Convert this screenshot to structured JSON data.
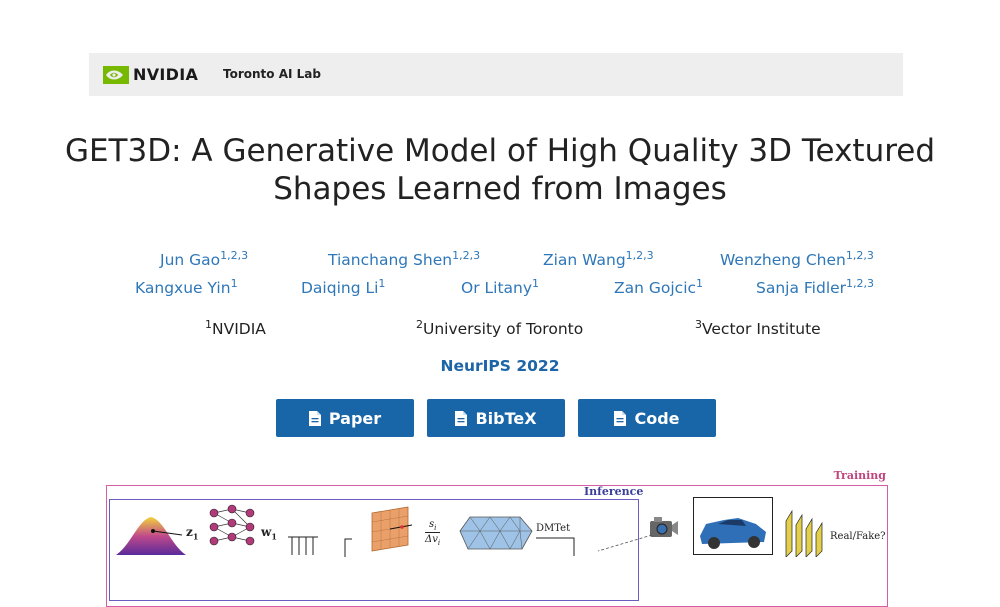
{
  "header": {
    "brand": "NVIDIA",
    "lab": "Toronto AI Lab"
  },
  "title": {
    "line1": "GET3D: A Generative Model of High Quality 3D Textured",
    "line2": "Shapes Learned from Images"
  },
  "authors": [
    {
      "name": "Jun Gao",
      "sup": "1,2,3"
    },
    {
      "name": "Tianchang Shen",
      "sup": "1,2,3"
    },
    {
      "name": "Zian Wang",
      "sup": "1,2,3"
    },
    {
      "name": "Wenzheng Chen",
      "sup": "1,2,3"
    },
    {
      "name": "Kangxue Yin",
      "sup": "1"
    },
    {
      "name": "Daiqing Li",
      "sup": "1"
    },
    {
      "name": "Or Litany",
      "sup": "1"
    },
    {
      "name": "Zan Gojcic",
      "sup": "1"
    },
    {
      "name": "Sanja Fidler",
      "sup": "1,2,3"
    }
  ],
  "affiliations": [
    {
      "sup": "1",
      "name": "NVIDIA"
    },
    {
      "sup": "2",
      "name": "University of Toronto"
    },
    {
      "sup": "3",
      "name": "Vector Institute"
    }
  ],
  "venue": "NeurIPS 2022",
  "buttons": {
    "paper": "Paper",
    "bibtex": "BibTeX",
    "code": "Code"
  },
  "figure": {
    "training_label": "Training",
    "inference_label": "Inference",
    "z1": "z",
    "z1_sub": "1",
    "w1": "w",
    "w1_sub": "1",
    "delta_top": "s",
    "delta_top_sub": "i",
    "delta_bottom": "Δv",
    "delta_bottom_sub": "i",
    "dmtet": "DMTet",
    "real_fake": "Real/Fake?"
  },
  "colors": {
    "button_bg": "#1865a8",
    "link": "#2e77b8",
    "nvidia_green": "#76b900"
  }
}
